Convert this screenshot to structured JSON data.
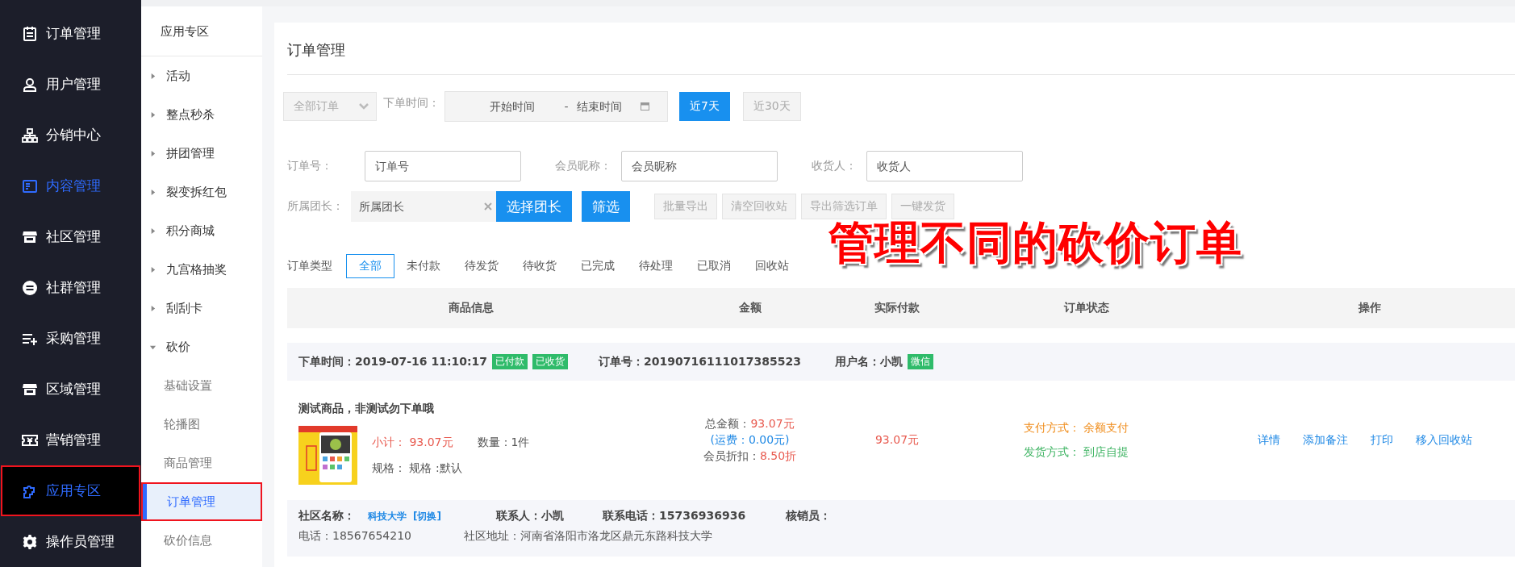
{
  "sidebar": {
    "items": [
      {
        "label": "订单管理",
        "selected": false,
        "hover": false,
        "highlighted": false
      },
      {
        "label": "用户管理",
        "selected": false,
        "hover": false,
        "highlighted": false
      },
      {
        "label": "分销中心",
        "selected": false,
        "hover": false,
        "highlighted": false
      },
      {
        "label": "内容管理",
        "selected": false,
        "hover": true,
        "highlighted": false
      },
      {
        "label": "社区管理",
        "selected": false,
        "hover": false,
        "highlighted": false
      },
      {
        "label": "社群管理",
        "selected": false,
        "hover": false,
        "highlighted": false
      },
      {
        "label": "采购管理",
        "selected": false,
        "hover": false,
        "highlighted": false
      },
      {
        "label": "区域管理",
        "selected": false,
        "hover": false,
        "highlighted": false
      },
      {
        "label": "营销管理",
        "selected": false,
        "hover": false,
        "highlighted": false
      },
      {
        "label": "应用专区",
        "selected": true,
        "hover": false,
        "highlighted": true
      },
      {
        "label": "操作员管理",
        "selected": false,
        "hover": false,
        "highlighted": false
      }
    ]
  },
  "subnav": {
    "title": "应用专区",
    "items": [
      {
        "label": "活动",
        "expanded": false
      },
      {
        "label": "整点秒杀",
        "expanded": false
      },
      {
        "label": "拼团管理",
        "expanded": false
      },
      {
        "label": "裂变拆红包",
        "expanded": false
      },
      {
        "label": "积分商城",
        "expanded": false
      },
      {
        "label": "九宫格抽奖",
        "expanded": false
      },
      {
        "label": "刮刮卡",
        "expanded": false
      },
      {
        "label": "砍价",
        "expanded": true,
        "children": [
          {
            "label": "基础设置",
            "selected": false,
            "highlighted": false
          },
          {
            "label": "轮播图",
            "selected": false,
            "highlighted": false
          },
          {
            "label": "商品管理",
            "selected": false,
            "highlighted": false
          },
          {
            "label": "订单管理",
            "selected": true,
            "highlighted": true
          },
          {
            "label": "砍价信息",
            "selected": false,
            "highlighted": false
          }
        ]
      }
    ]
  },
  "page": {
    "title": "订单管理",
    "scope_select": {
      "value": "全部订单"
    },
    "time_label": "下单时间：",
    "start": {
      "placeholder": "开始时间"
    },
    "separator": "-",
    "end": {
      "placeholder": "结束时间"
    },
    "ranges": [
      {
        "label": "近7天",
        "selected": true
      },
      {
        "label": "近30天",
        "selected": false
      }
    ],
    "fields": [
      {
        "label": "订单号：",
        "placeholder": "订单号"
      },
      {
        "label": "会员昵称：",
        "placeholder": "会员昵称"
      },
      {
        "label": "收货人：",
        "placeholder": "收货人"
      }
    ],
    "leader": {
      "label": "所属团长：",
      "placeholder": "所属团长"
    },
    "buttons": [
      {
        "label": "选择团长",
        "kind": "primary"
      },
      {
        "label": "筛选",
        "kind": "primary"
      },
      {
        "label": "批量导出",
        "kind": "plain"
      },
      {
        "label": "清空回收站",
        "kind": "plain"
      },
      {
        "label": "导出筛选订单",
        "kind": "plain"
      },
      {
        "label": "一键发货",
        "kind": "plain"
      }
    ],
    "caption": "管理不同的砍价订单",
    "type_label": "订单类型",
    "types": [
      {
        "label": "全部",
        "selected": true
      },
      {
        "label": "未付款",
        "selected": false
      },
      {
        "label": "待发货",
        "selected": false
      },
      {
        "label": "待收货",
        "selected": false
      },
      {
        "label": "已完成",
        "selected": false
      },
      {
        "label": "待处理",
        "selected": false
      },
      {
        "label": "已取消",
        "selected": false
      },
      {
        "label": "回收站",
        "selected": false
      }
    ],
    "table": {
      "columns": [
        "商品信息",
        "金额",
        "实际付款",
        "订单状态",
        "操作"
      ],
      "orders": [
        {
          "time_label": "下单时间：",
          "time": "2019-07-16 11:10:17",
          "tags": [
            "已付款",
            "已收货"
          ],
          "order_no_label": "订单号：",
          "order_no": "20190716111017385523",
          "user_label": "用户名：",
          "user": "小凯",
          "user_tag": "微信",
          "product": {
            "kind": "picture",
            "name": "测试商品，非测试勿下单哦",
            "subtotal_label": "小计：",
            "subtotal": "93.07元",
            "qty": "数量：1件",
            "spec_label": "规格：",
            "spec": "规格 :默认"
          },
          "total_label": "总金额：",
          "total": "93.07元",
          "shipping": "(运费：0.00元)",
          "discount_label": "会员折扣：",
          "discount": "8.50折",
          "paid": "93.07元",
          "pay_label": "支付方式：",
          "pay": "余额支付",
          "delivery_label": "发货方式：",
          "delivery": "到店自提",
          "actions": [
            "详情",
            "添加备注",
            "打印",
            "移入回收站"
          ],
          "community_label": "社区名称：",
          "community": "科技大学",
          "switch": "[切换]",
          "contact": "联系人：小凯",
          "contact_phone": "联系电话：15736936936",
          "verifier": "核销员：",
          "phone": "电话：18567654210",
          "address": "社区地址：河南省洛阳市洛龙区鼎元东路科技大学"
        }
      ]
    }
  }
}
